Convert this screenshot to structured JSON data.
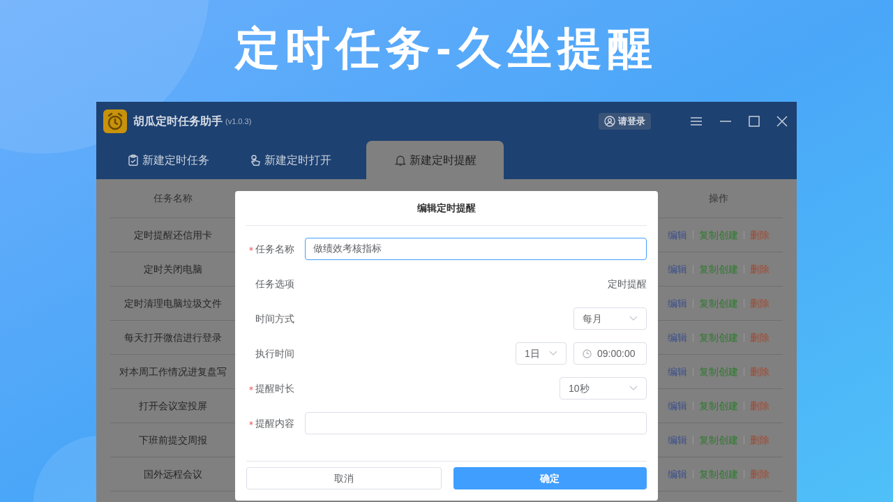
{
  "page_title": "定时任务-久坐提醒",
  "app": {
    "name": "胡瓜定时任务助手",
    "version": "(v1.0.3)",
    "login_button": "请登录"
  },
  "tabs": [
    {
      "label": "新建定时任务",
      "selected": false,
      "kind": "task"
    },
    {
      "label": "新建定时打开",
      "selected": false,
      "kind": "open"
    },
    {
      "label": "新建定时提醒",
      "selected": true,
      "kind": "reminder"
    }
  ],
  "table": {
    "columns": [
      "任务名称",
      "操作"
    ],
    "rows": [
      {
        "name": "定时提醒还信用卡",
        "actions": [
          {
            "label": "编辑",
            "kind": "edit"
          },
          {
            "label": "复制创建",
            "kind": "copy"
          },
          {
            "label": "删除",
            "kind": "delete"
          }
        ]
      },
      {
        "name": "定时关闭电脑",
        "actions": [
          {
            "label": "编辑",
            "kind": "edit"
          },
          {
            "label": "复制创建",
            "kind": "copy"
          },
          {
            "label": "删除",
            "kind": "delete"
          }
        ]
      },
      {
        "name": "定时清理电脑垃圾文件",
        "actions": [
          {
            "label": "编辑",
            "kind": "edit"
          },
          {
            "label": "复制创建",
            "kind": "copy"
          },
          {
            "label": "删除",
            "kind": "delete"
          }
        ]
      },
      {
        "name": "每天打开微信进行登录",
        "actions": [
          {
            "label": "编辑",
            "kind": "edit"
          },
          {
            "label": "复制创建",
            "kind": "copy"
          },
          {
            "label": "删除",
            "kind": "delete"
          }
        ]
      },
      {
        "name": "对本周工作情况进复盘写",
        "actions": [
          {
            "label": "编辑",
            "kind": "edit"
          },
          {
            "label": "复制创建",
            "kind": "copy"
          },
          {
            "label": "删除",
            "kind": "delete"
          }
        ]
      },
      {
        "name": "打开会议室投屏",
        "actions": [
          {
            "label": "编辑",
            "kind": "edit"
          },
          {
            "label": "复制创建",
            "kind": "copy"
          },
          {
            "label": "删除",
            "kind": "delete"
          }
        ]
      },
      {
        "name": "下班前提交周报",
        "actions": [
          {
            "label": "编辑",
            "kind": "edit"
          },
          {
            "label": "复制创建",
            "kind": "copy"
          },
          {
            "label": "删除",
            "kind": "delete"
          }
        ]
      },
      {
        "name": "国外远程会议",
        "actions": [
          {
            "label": "编辑",
            "kind": "edit"
          },
          {
            "label": "复制创建",
            "kind": "copy"
          },
          {
            "label": "删除",
            "kind": "delete"
          }
        ]
      }
    ]
  },
  "dialog": {
    "title": "编辑定时提醒",
    "fields": [
      {
        "label": "任务名称",
        "required": true,
        "controls": [
          {
            "kind": "input",
            "value": "做绩效考核指标",
            "focused": true
          }
        ]
      },
      {
        "label": "任务选项",
        "required": false,
        "controls": [
          {
            "kind": "text",
            "value": "定时提醒"
          }
        ]
      },
      {
        "label": "时间方式",
        "required": false,
        "controls": [
          {
            "kind": "select",
            "value": "每月"
          }
        ]
      },
      {
        "label": "执行时间",
        "required": false,
        "controls": [
          {
            "kind": "select",
            "value": "1日"
          },
          {
            "kind": "time",
            "value": "09:00:00"
          }
        ]
      },
      {
        "label": "提醒时长",
        "required": true,
        "controls": [
          {
            "kind": "select",
            "value": "10秒"
          }
        ]
      },
      {
        "label": "提醒内容",
        "required": true,
        "controls": [
          {
            "kind": "input",
            "focused": false
          }
        ]
      }
    ],
    "buttons": [
      {
        "label": "取消",
        "primary": false
      },
      {
        "label": "确定",
        "primary": true
      }
    ]
  }
}
